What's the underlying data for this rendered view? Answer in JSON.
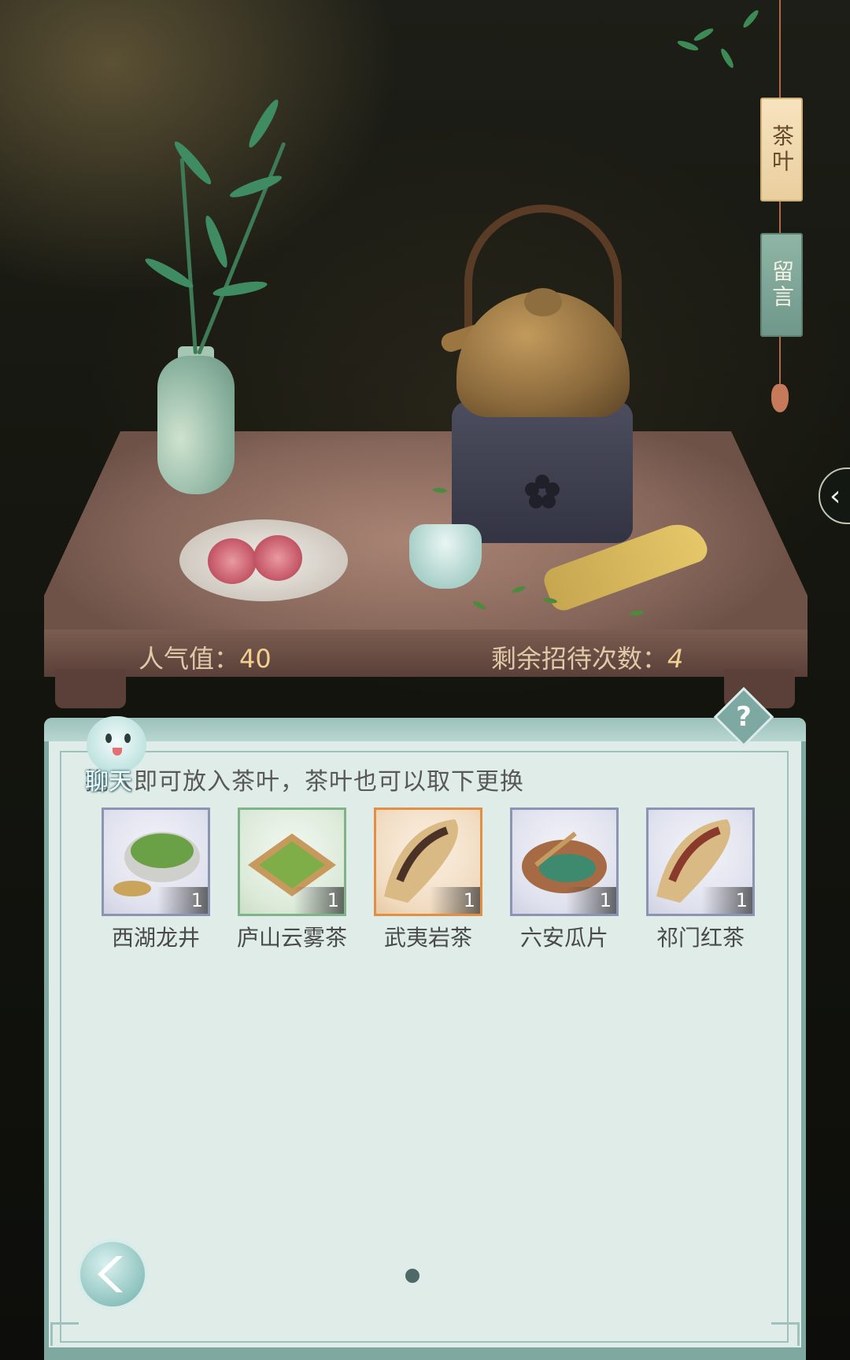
{
  "side_tabs": {
    "tea": "茶叶",
    "message": "留言"
  },
  "stats": {
    "popularity_label": "人气值：",
    "popularity_value": "40",
    "remaining_label": "剩余招待次数：",
    "remaining_value": "4"
  },
  "help": {
    "symbol": "?"
  },
  "panel": {
    "mascot_label": "聊天",
    "hint": "拖入即可放入茶叶，茶叶也可以取下更换",
    "items": [
      {
        "name": "西湖龙井",
        "count": "1",
        "frame": "blue"
      },
      {
        "name": "庐山云雾茶",
        "count": "1",
        "frame": "green"
      },
      {
        "name": "武夷岩茶",
        "count": "1",
        "frame": "orange"
      },
      {
        "name": "六安瓜片",
        "count": "1",
        "frame": "blue"
      },
      {
        "name": "祁门红茶",
        "count": "1",
        "frame": "blue"
      }
    ]
  },
  "icons": {
    "side_arrow": "chevron-left-icon",
    "back": "back-arrow-icon",
    "help": "question-icon"
  },
  "colors": {
    "panel_bg": "#dfece8",
    "panel_border": "#7fa8a1",
    "stat_value": "#f2d08f"
  }
}
